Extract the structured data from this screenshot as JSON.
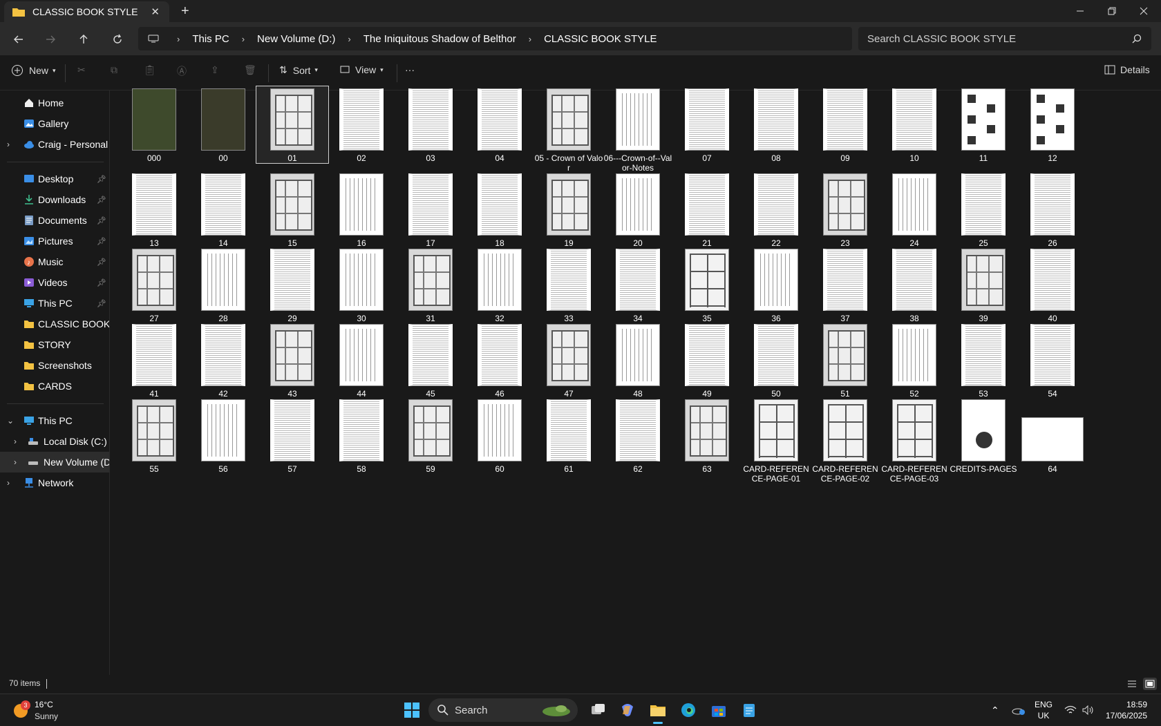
{
  "window": {
    "tab_title": "CLASSIC BOOK STYLE",
    "new_tab": "+"
  },
  "breadcrumb": [
    "This PC",
    "New Volume (D:)",
    "The Iniquitous Shadow of Belthor",
    "CLASSIC BOOK STYLE"
  ],
  "search": {
    "placeholder": "Search CLASSIC BOOK STYLE"
  },
  "toolbar": {
    "new_label": "New",
    "sort_label": "Sort",
    "view_label": "View",
    "more_label": "···",
    "details_label": "Details"
  },
  "sidebar": {
    "home": "Home",
    "gallery": "Gallery",
    "onedrive": "Craig - Personal",
    "quick": [
      {
        "label": "Desktop",
        "icon": "desktop-icon"
      },
      {
        "label": "Downloads",
        "icon": "downloads-icon"
      },
      {
        "label": "Documents",
        "icon": "documents-icon"
      },
      {
        "label": "Pictures",
        "icon": "pictures-icon"
      },
      {
        "label": "Music",
        "icon": "music-icon"
      },
      {
        "label": "Videos",
        "icon": "videos-icon"
      },
      {
        "label": "This PC",
        "icon": "this-pc-icon"
      },
      {
        "label": "CLASSIC BOOK STYLE",
        "icon": "folder-icon"
      },
      {
        "label": "STORY",
        "icon": "folder-icon"
      },
      {
        "label": "Screenshots",
        "icon": "folder-icon"
      },
      {
        "label": "CARDS",
        "icon": "folder-icon"
      }
    ],
    "this_pc": "This PC",
    "local_disk": "Local Disk (C:)",
    "new_volume": "New Volume (D:)",
    "network": "Network"
  },
  "files": [
    {
      "name": "000",
      "kind": "cover1"
    },
    {
      "name": "00",
      "kind": "cover2"
    },
    {
      "name": "01",
      "kind": "map"
    },
    {
      "name": "02",
      "kind": "text"
    },
    {
      "name": "03",
      "kind": "text"
    },
    {
      "name": "04",
      "kind": "text"
    },
    {
      "name": "05 - Crown of Valor",
      "kind": "map"
    },
    {
      "name": "06---Crown-of--Valor-Notes",
      "kind": "cols"
    },
    {
      "name": "07",
      "kind": "text"
    },
    {
      "name": "08",
      "kind": "text"
    },
    {
      "name": "09",
      "kind": "text"
    },
    {
      "name": "10",
      "kind": "text"
    },
    {
      "name": "11",
      "kind": "portrait"
    },
    {
      "name": "12",
      "kind": "portrait"
    },
    {
      "name": "13",
      "kind": "text"
    },
    {
      "name": "14",
      "kind": "text"
    },
    {
      "name": "15",
      "kind": "map"
    },
    {
      "name": "16",
      "kind": "cols"
    },
    {
      "name": "17",
      "kind": "text"
    },
    {
      "name": "18",
      "kind": "text"
    },
    {
      "name": "19",
      "kind": "map"
    },
    {
      "name": "20",
      "kind": "cols"
    },
    {
      "name": "21",
      "kind": "text"
    },
    {
      "name": "22",
      "kind": "text"
    },
    {
      "name": "23",
      "kind": "map"
    },
    {
      "name": "24",
      "kind": "cols"
    },
    {
      "name": "25",
      "kind": "text"
    },
    {
      "name": "26",
      "kind": "text"
    },
    {
      "name": "27",
      "kind": "map"
    },
    {
      "name": "28",
      "kind": "cols"
    },
    {
      "name": "29",
      "kind": "text"
    },
    {
      "name": "30",
      "kind": "cols"
    },
    {
      "name": "31",
      "kind": "map"
    },
    {
      "name": "32",
      "kind": "cols"
    },
    {
      "name": "33",
      "kind": "text"
    },
    {
      "name": "34",
      "kind": "text"
    },
    {
      "name": "35",
      "kind": "cards"
    },
    {
      "name": "36",
      "kind": "cols"
    },
    {
      "name": "37",
      "kind": "text"
    },
    {
      "name": "38",
      "kind": "text"
    },
    {
      "name": "39",
      "kind": "map"
    },
    {
      "name": "40",
      "kind": "text"
    },
    {
      "name": "41",
      "kind": "text"
    },
    {
      "name": "42",
      "kind": "text"
    },
    {
      "name": "43",
      "kind": "map"
    },
    {
      "name": "44",
      "kind": "cols"
    },
    {
      "name": "45",
      "kind": "text"
    },
    {
      "name": "46",
      "kind": "text"
    },
    {
      "name": "47",
      "kind": "map"
    },
    {
      "name": "48",
      "kind": "cols"
    },
    {
      "name": "49",
      "kind": "text"
    },
    {
      "name": "50",
      "kind": "text"
    },
    {
      "name": "51",
      "kind": "map"
    },
    {
      "name": "52",
      "kind": "cols"
    },
    {
      "name": "53",
      "kind": "text"
    },
    {
      "name": "54",
      "kind": "text"
    },
    {
      "name": "55",
      "kind": "map"
    },
    {
      "name": "56",
      "kind": "cols"
    },
    {
      "name": "57",
      "kind": "text"
    },
    {
      "name": "58",
      "kind": "text"
    },
    {
      "name": "59",
      "kind": "map"
    },
    {
      "name": "60",
      "kind": "cols"
    },
    {
      "name": "61",
      "kind": "text"
    },
    {
      "name": "62",
      "kind": "text"
    },
    {
      "name": "63",
      "kind": "map"
    },
    {
      "name": "CARD-REFERENCE-PAGE-01",
      "kind": "cards"
    },
    {
      "name": "CARD-REFERENCE-PAGE-02",
      "kind": "cards"
    },
    {
      "name": "CARD-REFERENCE-PAGE-03",
      "kind": "cards"
    },
    {
      "name": "CREDITS-PAGES",
      "kind": "face"
    },
    {
      "name": "64",
      "kind": "wide"
    }
  ],
  "status": {
    "item_count": "70 items"
  },
  "taskbar": {
    "weather_badge": "3",
    "temperature": "16°C",
    "condition": "Sunny",
    "search_label": "Search",
    "lang_1": "ENG",
    "lang_2": "UK",
    "time": "18:59",
    "date": "17/06/2025"
  },
  "colors": {
    "folder": "#f3c242",
    "accent": "#4cc2ff",
    "background": "#191919"
  }
}
